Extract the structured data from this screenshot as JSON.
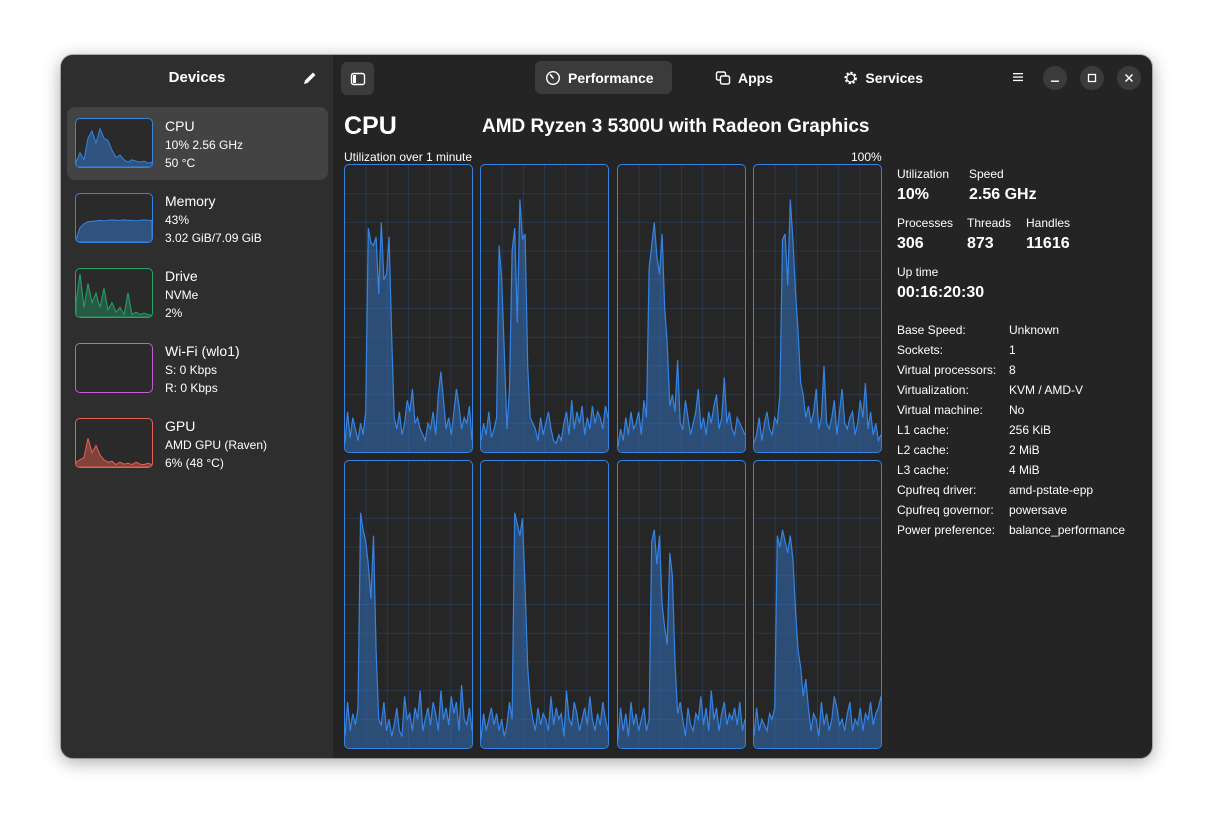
{
  "sidebar": {
    "title": "Devices",
    "devices": [
      {
        "name": "CPU",
        "line1": "10% 2.56 GHz",
        "line2": "50 °C",
        "color": "#3584e4",
        "selected": true
      },
      {
        "name": "Memory",
        "line1": "43%",
        "line2": "3.02 GiB/7.09 GiB",
        "color": "#3584e4"
      },
      {
        "name": "Drive",
        "line1": "NVMe",
        "line2": "2%",
        "color": "#26a269"
      },
      {
        "name": "Wi-Fi (wlo1)",
        "line1": "S: 0 Kbps",
        "line2": "R: 0 Kbps",
        "color": "#c061cb"
      },
      {
        "name": "GPU",
        "line1": "AMD GPU (Raven)",
        "line2": "6% (48 °C)",
        "color": "#e66151"
      }
    ]
  },
  "header": {
    "tabs": [
      {
        "label": "Performance",
        "icon": "speedometer-icon",
        "active": true
      },
      {
        "label": "Apps",
        "icon": "windows-icon"
      },
      {
        "label": "Services",
        "icon": "gear-icon"
      }
    ],
    "buttons": [
      "sidebar-toggle-icon",
      "edit-icon",
      "hamburger-menu-icon",
      "minimize-icon",
      "maximize-icon",
      "close-icon"
    ]
  },
  "main": {
    "title": "CPU",
    "model": "AMD Ryzen 3 5300U with Radeon Graphics",
    "graph_label": "Utilization over 1 minute",
    "graph_max": "100%",
    "accent": "#3584e4"
  },
  "stats": {
    "utilization_label": "Utilization",
    "utilization": "10%",
    "speed_label": "Speed",
    "speed": "2.56 GHz",
    "processes_label": "Processes",
    "processes": "306",
    "threads_label": "Threads",
    "threads": "873",
    "handles_label": "Handles",
    "handles": "11616",
    "uptime_label": "Up time",
    "uptime": "00:16:20:30"
  },
  "info": [
    {
      "key": "Base Speed:",
      "value": "Unknown"
    },
    {
      "key": "Sockets:",
      "value": "1"
    },
    {
      "key": "Virtual processors:",
      "value": "8"
    },
    {
      "key": "Virtualization:",
      "value": "KVM / AMD-V"
    },
    {
      "key": "Virtual machine:",
      "value": "No"
    },
    {
      "key": "L1 cache:",
      "value": "256 KiB"
    },
    {
      "key": "L2 cache:",
      "value": "2 MiB"
    },
    {
      "key": "L3 cache:",
      "value": "4 MiB"
    },
    {
      "key": "Cpufreq driver:",
      "value": "amd-pstate-epp"
    },
    {
      "key": "Cpufreq governor:",
      "value": "powersave"
    },
    {
      "key": "Power preference:",
      "value": "balance_performance"
    }
  ],
  "chart_data": {
    "type": "area",
    "title": "Utilization over 1 minute",
    "ylim": [
      0,
      100
    ],
    "series": [
      {
        "values": [
          3,
          14,
          5,
          12,
          8,
          4,
          10,
          6,
          14,
          78,
          73,
          72,
          75,
          55,
          80,
          60,
          62,
          75,
          40,
          12,
          8,
          14,
          6,
          10,
          18,
          14,
          22,
          10,
          12,
          8,
          6,
          4,
          10,
          8,
          14,
          6,
          20,
          28,
          18,
          8,
          12,
          6,
          14,
          22,
          16,
          8,
          12,
          10,
          16,
          4
        ]
      },
      {
        "values": [
          4,
          10,
          6,
          14,
          5,
          8,
          12,
          72,
          60,
          35,
          8,
          22,
          70,
          78,
          45,
          88,
          74,
          76,
          30,
          12,
          10,
          8,
          4,
          12,
          6,
          10,
          14,
          8,
          4,
          3,
          6,
          4,
          10,
          14,
          6,
          18,
          8,
          14,
          10,
          16,
          6,
          12,
          8,
          16,
          10,
          14,
          12,
          8,
          16,
          12
        ]
      },
      {
        "values": [
          2,
          8,
          4,
          12,
          6,
          14,
          8,
          10,
          14,
          6,
          18,
          12,
          64,
          72,
          80,
          68,
          62,
          76,
          50,
          38,
          16,
          20,
          14,
          32,
          10,
          8,
          18,
          12,
          6,
          10,
          14,
          22,
          8,
          12,
          6,
          14,
          10,
          16,
          20,
          8,
          12,
          26,
          10,
          14,
          8,
          6,
          12,
          10,
          8,
          6
        ]
      },
      {
        "values": [
          3,
          6,
          12,
          4,
          10,
          14,
          8,
          6,
          12,
          10,
          20,
          74,
          76,
          58,
          88,
          74,
          56,
          42,
          24,
          20,
          12,
          16,
          10,
          14,
          22,
          8,
          12,
          30,
          10,
          8,
          12,
          18,
          6,
          14,
          22,
          10,
          8,
          12,
          14,
          6,
          10,
          18,
          12,
          24,
          8,
          14,
          6,
          10,
          4,
          6
        ]
      },
      {
        "values": [
          4,
          16,
          6,
          12,
          8,
          14,
          82,
          76,
          72,
          64,
          52,
          74,
          34,
          10,
          8,
          16,
          6,
          10,
          4,
          8,
          14,
          6,
          4,
          18,
          10,
          12,
          6,
          14,
          10,
          20,
          6,
          10,
          14,
          8,
          16,
          12,
          6,
          20,
          10,
          14,
          8,
          18,
          12,
          16,
          6,
          22,
          10,
          8,
          14,
          6
        ]
      },
      {
        "values": [
          3,
          12,
          6,
          10,
          14,
          8,
          12,
          6,
          10,
          4,
          8,
          16,
          10,
          82,
          78,
          74,
          80,
          56,
          28,
          16,
          10,
          6,
          14,
          8,
          12,
          10,
          6,
          18,
          8,
          14,
          10,
          12,
          4,
          20,
          10,
          8,
          16,
          12,
          6,
          10,
          14,
          8,
          18,
          10,
          6,
          12,
          8,
          16,
          10,
          6
        ]
      },
      {
        "values": [
          3,
          14,
          6,
          12,
          4,
          16,
          8,
          12,
          6,
          10,
          14,
          6,
          10,
          72,
          76,
          64,
          74,
          50,
          42,
          36,
          68,
          60,
          30,
          12,
          16,
          10,
          4,
          14,
          8,
          6,
          12,
          10,
          18,
          8,
          14,
          6,
          20,
          10,
          14,
          6,
          12,
          16,
          8,
          12,
          10,
          14,
          8,
          16,
          6,
          10
        ]
      },
      {
        "values": [
          4,
          14,
          6,
          10,
          8,
          6,
          12,
          10,
          14,
          74,
          70,
          76,
          72,
          68,
          74,
          66,
          48,
          34,
          28,
          18,
          24,
          14,
          6,
          12,
          10,
          4,
          16,
          8,
          12,
          6,
          10,
          18,
          14,
          8,
          10,
          6,
          12,
          16,
          6,
          10,
          8,
          14,
          6,
          12,
          10,
          16,
          8,
          12,
          14,
          18
        ]
      }
    ]
  }
}
